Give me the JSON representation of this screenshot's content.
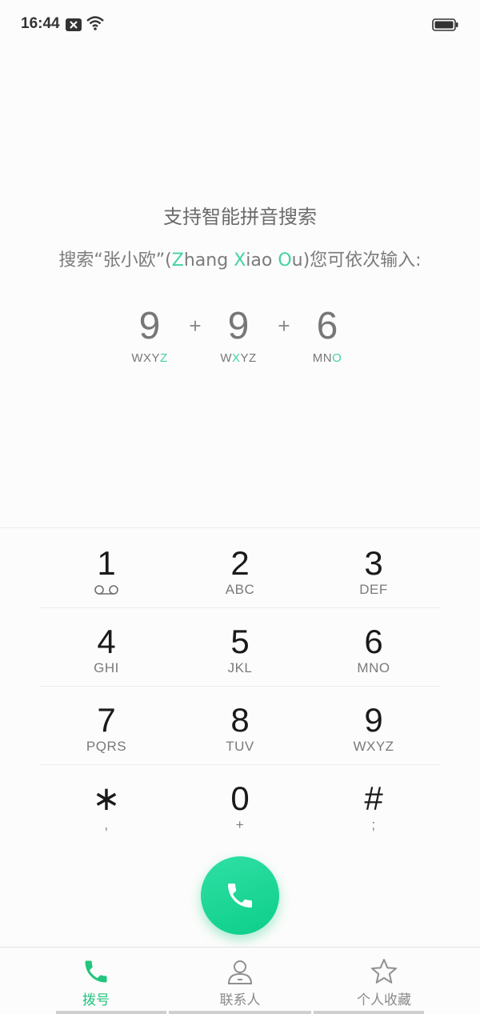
{
  "status_bar": {
    "time": "16:44"
  },
  "hint": {
    "title": "支持智能拼音搜索",
    "line_prefix": "搜索“张小欧”(",
    "z": "Z",
    "hang": "hang ",
    "x": "X",
    "iao": "iao ",
    "o": "O",
    "u": "u",
    "line_suffix": ")您可依次输入:"
  },
  "example": {
    "plus": "+",
    "items": [
      {
        "digit": "9",
        "letters_pre": "WXY",
        "letters_acc": "Z",
        "letters_post": ""
      },
      {
        "digit": "9",
        "letters_pre": "W",
        "letters_acc": "X",
        "letters_post": "YZ"
      },
      {
        "digit": "6",
        "letters_pre": "MN",
        "letters_acc": "O",
        "letters_post": ""
      }
    ]
  },
  "keypad": {
    "keys": [
      {
        "num": "1",
        "sub": ""
      },
      {
        "num": "2",
        "sub": "ABC"
      },
      {
        "num": "3",
        "sub": "DEF"
      },
      {
        "num": "4",
        "sub": "GHI"
      },
      {
        "num": "5",
        "sub": "JKL"
      },
      {
        "num": "6",
        "sub": "MNO"
      },
      {
        "num": "7",
        "sub": "PQRS"
      },
      {
        "num": "8",
        "sub": "TUV"
      },
      {
        "num": "9",
        "sub": "WXYZ"
      },
      {
        "num": "∗",
        "sub": ","
      },
      {
        "num": "0",
        "sub": "+"
      },
      {
        "num": "#",
        "sub": ";"
      }
    ]
  },
  "tabs": {
    "dial": "拨号",
    "contacts": "联系人",
    "favorites": "个人收藏"
  },
  "colors": {
    "accent": "#43d39e",
    "call_button": "#12d28f",
    "active_tab": "#22c47e"
  },
  "icons": {
    "voicemail": "voicemail-icon",
    "call": "phone-icon",
    "dial_tab": "phone-icon",
    "contacts_tab": "person-icon",
    "favorites_tab": "star-icon"
  }
}
